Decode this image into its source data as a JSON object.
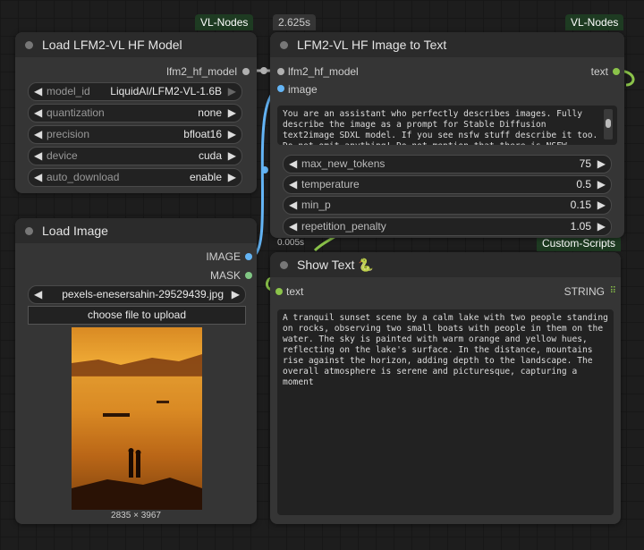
{
  "tags": {
    "vl_nodes_left": "VL-Nodes",
    "vl_nodes_right": "VL-Nodes",
    "time_top": "2.625s",
    "time_mid": "0.005s",
    "custom_scripts": "Custom-Scripts"
  },
  "load_model": {
    "title": "Load LFM2-VL HF Model",
    "output": "lfm2_hf_model",
    "widgets": [
      {
        "label": "model_id",
        "value": "LiquidAI/LFM2-VL-1.6B"
      },
      {
        "label": "quantization",
        "value": "none"
      },
      {
        "label": "precision",
        "value": "bfloat16"
      },
      {
        "label": "device",
        "value": "cuda"
      },
      {
        "label": "auto_download",
        "value": "enable"
      }
    ]
  },
  "image_to_text": {
    "title": "LFM2-VL HF Image to Text",
    "input_model": "lfm2_hf_model",
    "input_image": "image",
    "output": "text",
    "prompt": "You are an assistant who perfectly describes images. Fully describe the image as a prompt for Stable Diffusion text2image SDXL model. If you see nsfw stuff describe it too. Do not omit anything! Do not mention that there is NSFW content setting, just",
    "widgets": [
      {
        "label": "max_new_tokens",
        "value": "75"
      },
      {
        "label": "temperature",
        "value": "0.5"
      },
      {
        "label": "min_p",
        "value": "0.15"
      },
      {
        "label": "repetition_penalty",
        "value": "1.05"
      }
    ]
  },
  "load_image": {
    "title": "Load Image",
    "output_image": "IMAGE",
    "output_mask": "MASK",
    "file": "pexels-enesersahin-29529439.jpg",
    "upload_label": "choose file to upload",
    "dimensions": "2835 × 3967"
  },
  "show_text": {
    "title": "Show Text 🐍",
    "input": "text",
    "output": "STRING",
    "content": "A tranquil sunset scene by a calm lake with two people standing on rocks, observing two small boats with people in them on the water. The sky is painted with warm orange and yellow hues, reflecting on the lake's surface. In the distance, mountains rise against the horizon, adding depth to the landscape. The overall atmosphere is serene and picturesque, capturing a moment"
  },
  "colors": {
    "model_link": "#b0b0b0",
    "image_link": "#64b5f6",
    "text_link": "#8bc34a"
  }
}
